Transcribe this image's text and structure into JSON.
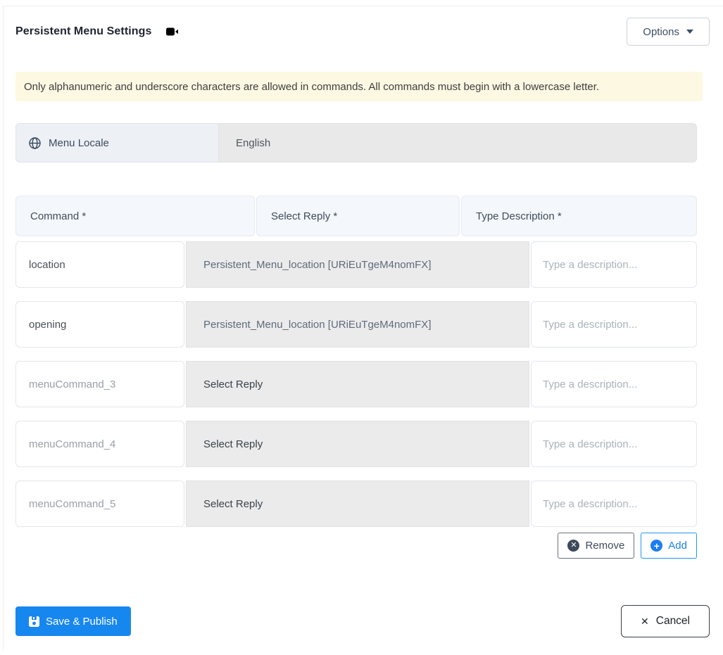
{
  "header": {
    "title": "Persistent Menu Settings",
    "options_label": "Options"
  },
  "alert": {
    "message": "Only alphanumeric and underscore characters are allowed in commands. All commands must begin with a lowercase letter."
  },
  "locale": {
    "label": "Menu Locale",
    "value": "English"
  },
  "table": {
    "headers": [
      "Command *",
      "Select Reply *",
      "Type Description *"
    ],
    "description_placeholder": "Type a description...",
    "rows": [
      {
        "command_value": "location",
        "command_placeholder": "",
        "reply": "Persistent_Menu_location [URiEuTgeM4nomFX]"
      },
      {
        "command_value": "opening",
        "command_placeholder": "",
        "reply": "Persistent_Menu_location [URiEuTgeM4nomFX]"
      },
      {
        "command_value": "",
        "command_placeholder": "menuCommand_3",
        "reply": "Select Reply"
      },
      {
        "command_value": "",
        "command_placeholder": "menuCommand_4",
        "reply": "Select Reply"
      },
      {
        "command_value": "",
        "command_placeholder": "menuCommand_5",
        "reply": "Select Reply"
      }
    ],
    "remove_label": "Remove",
    "add_label": "Add"
  },
  "footer": {
    "save_label": "Save & Publish",
    "cancel_label": "Cancel"
  },
  "icons": {
    "remove_glyph": "✕",
    "add_glyph": "+",
    "cancel_glyph": "✕"
  },
  "colors": {
    "primary_blue": "#1787f0",
    "add_blue": "#2196f3",
    "alert_bg": "#fdf8e2",
    "header_cell_bg": "#f4f7fb",
    "disabled_gray": "#ebebeb"
  }
}
